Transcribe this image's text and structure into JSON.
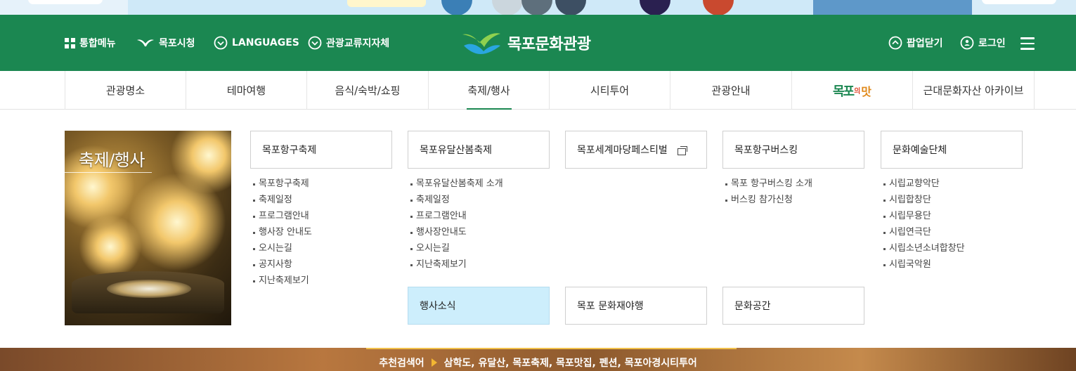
{
  "header": {
    "links": [
      {
        "label": "통합메뉴",
        "icon": "grid-icon"
      },
      {
        "label": "목포시청",
        "icon": "seagull-icon"
      },
      {
        "label": "LANGUAGES",
        "icon": "chevron-circle-icon"
      },
      {
        "label": "관광교류지자체",
        "icon": "chevron-circle-icon"
      }
    ],
    "brand_title": "목포문화관광",
    "popup_close": "팝업닫기",
    "login": "로그인",
    "colors": {
      "header_bg": "#1b8751",
      "accent": "#1b8751"
    }
  },
  "nav": {
    "items": [
      "관광명소",
      "테마여행",
      "음식/숙박/쇼핑",
      "축제/행사",
      "시티투어",
      "관광안내",
      "",
      "근대문화자산 아카이브"
    ],
    "active_index": 3,
    "taste_logo": {
      "part1": "목포",
      "part2": "의",
      "part3": "맛"
    }
  },
  "mega": {
    "title": "축제/행사",
    "categories": [
      {
        "label": "목포항구축제",
        "items": [
          "목포항구축제",
          "축제일정",
          "프로그램안내",
          "행사장 안내도",
          "오시는길",
          "공지사항",
          "지난축제보기"
        ]
      },
      {
        "label": "목포유달산봄축제",
        "items": [
          "목포유달산봄축제 소개",
          "축제일정",
          "프로그램안내",
          "행사장안내도",
          "오시는길",
          "지난축제보기"
        ]
      },
      {
        "label": "목포세계마당페스티벌",
        "external": true,
        "items": []
      },
      {
        "label": "목포항구버스킹",
        "items": [
          "목포 항구버스킹 소개",
          "버스킹 참가신청"
        ]
      },
      {
        "label": "문화예술단체",
        "items": [
          "시립교향악단",
          "시립합창단",
          "시립무용단",
          "시립연극단",
          "시립소년소녀합창단",
          "시립국악원"
        ]
      }
    ],
    "row2": [
      {
        "label": "행사소식",
        "highlighted": true
      },
      {
        "label": "목포 문화재야행"
      },
      {
        "label": "문화공간"
      }
    ]
  },
  "footer": {
    "recommend_label": "추천검색어",
    "recommend_terms": "삼학도, 유달산, 목포축제, 목포맛집, 펜션, 목포아경시티투어"
  }
}
